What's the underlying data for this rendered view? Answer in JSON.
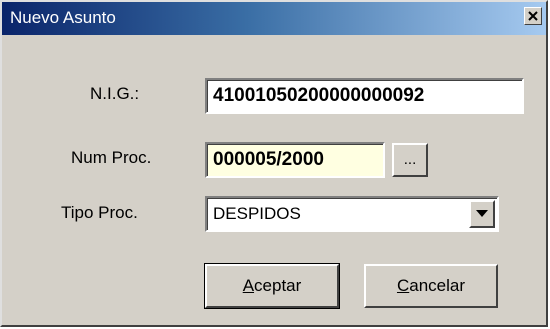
{
  "window": {
    "title": "Nuevo Asunto",
    "close_glyph": "×"
  },
  "form": {
    "nig": {
      "label": "N.I.G.:",
      "value": "41001050200000000092"
    },
    "num_proc": {
      "label": "Num Proc.",
      "value": "000005/2000",
      "browse_label": "..."
    },
    "tipo_proc": {
      "label": "Tipo Proc.",
      "value": "DESPIDOS"
    }
  },
  "buttons": {
    "accept": {
      "mnemonic": "A",
      "rest": "ceptar"
    },
    "cancel": {
      "mnemonic": "C",
      "rest": "ancelar"
    }
  },
  "colors": {
    "dialog_face": "#d4d0c8",
    "title_gradient_start": "#0a246a",
    "title_gradient_end": "#a6caf0",
    "highlight_field": "#ffffe1"
  },
  "icons": {
    "close": "close-icon",
    "dropdown": "chevron-down-icon"
  }
}
